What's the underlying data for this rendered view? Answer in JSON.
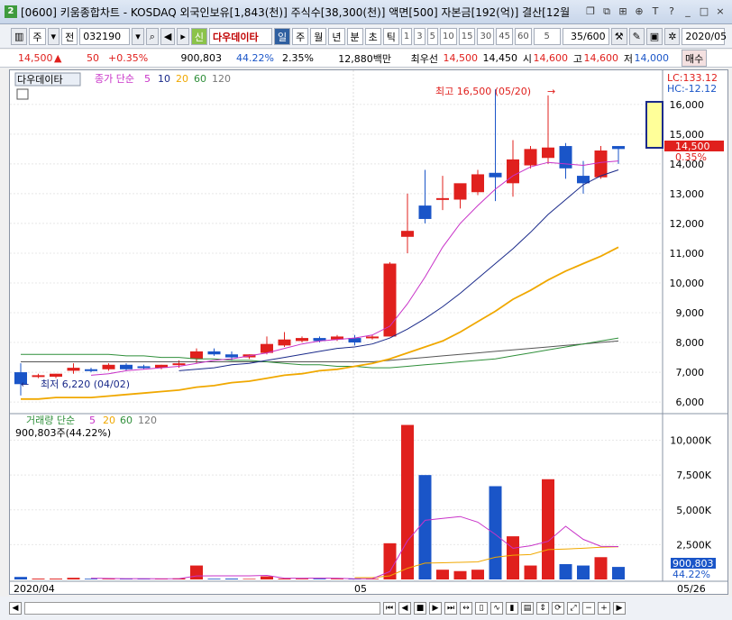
{
  "window": {
    "number": "2",
    "title": "[0600] 키움종합차트 - KOSDAQ 외국인보유[1,843(천)] 주식수[38,300(천)] 액면[500] 자본금[192(억)] 결산[12월"
  },
  "toolbar": {
    "market": "주",
    "prev": "전",
    "code": "032190",
    "search_icon": "search-icon",
    "badge": "신",
    "stock_name": "다우데이타",
    "periods": [
      "일",
      "주",
      "월",
      "년",
      "분",
      "초",
      "틱"
    ],
    "selected_period": "일",
    "intervals": [
      "1",
      "3",
      "5",
      "10",
      "15",
      "30",
      "45",
      "60"
    ],
    "interval_select": "5",
    "count": "35/600",
    "date": "2020/05"
  },
  "info": {
    "price": "14,500",
    "arrow": "▲",
    "change": "50",
    "change_pct": "+0.35%",
    "volume": "900,803",
    "vol_ratio": "44.22%",
    "turnover": "2.35%",
    "trade_value": "12,880백만",
    "best_label": "최우선",
    "best_ask": "14,500",
    "best_bid": "14,450",
    "open_label": "시",
    "open": "14,600",
    "high_label": "고",
    "high": "14,600",
    "low_label": "저",
    "low": "14,000",
    "buy_button": "매수"
  },
  "price_panel": {
    "stock": "다우데이타",
    "legend_label": "종가 단순",
    "ma": [
      "5",
      "10",
      "20",
      "60",
      "120"
    ],
    "lc": "LC:133.12",
    "hc": "HC:-12.12",
    "high_note": "최고 16,500 (05/20)",
    "low_note": "최저 6,220 (04/02)",
    "last_price": "14,500",
    "last_pct": "0.35%",
    "y_ticks": [
      "16,000",
      "15,000",
      "14,000",
      "13,000",
      "12,000",
      "11,000",
      "10,000",
      "9,000",
      "8,000",
      "7,000",
      "6,000"
    ]
  },
  "volume_panel": {
    "legend_label": "거래량 단순",
    "ma": [
      "5",
      "20",
      "60",
      "120"
    ],
    "current": "900,803주(44.22%)",
    "y_ticks": [
      "10,000K",
      "7,500K",
      "5,000K",
      "2,500K"
    ],
    "last_volume": "900,803",
    "last_pct": "44.22%"
  },
  "x_axis": {
    "labels": [
      "2020/04",
      "05",
      "05/26"
    ]
  },
  "colors": {
    "up": "#e0201d",
    "down": "#1a55c8",
    "ma5": "#c832c8",
    "ma10": "#1a2a8a",
    "ma20": "#f0a800",
    "ma60": "#2f8f3a",
    "ma120": "#555555"
  },
  "chart_data": {
    "type": "candlestick",
    "candles": [
      {
        "o": 7000,
        "h": 7300,
        "l": 6220,
        "c": 6600
      },
      {
        "o": 6850,
        "h": 6950,
        "l": 6800,
        "c": 6900
      },
      {
        "o": 6850,
        "h": 6950,
        "l": 6800,
        "c": 6950
      },
      {
        "o": 7050,
        "h": 7300,
        "l": 6950,
        "c": 7150
      },
      {
        "o": 7100,
        "h": 7150,
        "l": 7000,
        "c": 7050
      },
      {
        "o": 7100,
        "h": 7300,
        "l": 7050,
        "c": 7250
      },
      {
        "o": 7250,
        "h": 7300,
        "l": 7050,
        "c": 7100
      },
      {
        "o": 7200,
        "h": 7250,
        "l": 7100,
        "c": 7150
      },
      {
        "o": 7150,
        "h": 7250,
        "l": 7100,
        "c": 7250
      },
      {
        "o": 7250,
        "h": 7400,
        "l": 7150,
        "c": 7300
      },
      {
        "o": 7450,
        "h": 7800,
        "l": 7300,
        "c": 7700
      },
      {
        "o": 7700,
        "h": 7800,
        "l": 7550,
        "c": 7600
      },
      {
        "o": 7600,
        "h": 7700,
        "l": 7400,
        "c": 7500
      },
      {
        "o": 7500,
        "h": 7600,
        "l": 7450,
        "c": 7600
      },
      {
        "o": 7650,
        "h": 8200,
        "l": 7600,
        "c": 7950
      },
      {
        "o": 7900,
        "h": 8350,
        "l": 7850,
        "c": 8100
      },
      {
        "o": 8050,
        "h": 8200,
        "l": 8000,
        "c": 8150
      },
      {
        "o": 8150,
        "h": 8200,
        "l": 8000,
        "c": 8050
      },
      {
        "o": 8100,
        "h": 8250,
        "l": 8050,
        "c": 8200
      },
      {
        "o": 8150,
        "h": 8250,
        "l": 7900,
        "c": 8000
      },
      {
        "o": 8150,
        "h": 8250,
        "l": 8100,
        "c": 8200
      },
      {
        "o": 8200,
        "h": 10700,
        "l": 8200,
        "c": 10650
      },
      {
        "o": 11550,
        "h": 13000,
        "l": 11000,
        "c": 11750
      },
      {
        "o": 12600,
        "h": 13800,
        "l": 12000,
        "c": 12150
      },
      {
        "o": 12800,
        "h": 13600,
        "l": 12450,
        "c": 12850
      },
      {
        "o": 12800,
        "h": 13100,
        "l": 12500,
        "c": 13350
      },
      {
        "o": 13050,
        "h": 13800,
        "l": 12950,
        "c": 13650
      },
      {
        "o": 13700,
        "h": 16500,
        "l": 12750,
        "c": 13550
      },
      {
        "o": 13350,
        "h": 14800,
        "l": 12900,
        "c": 14150
      },
      {
        "o": 13950,
        "h": 14600,
        "l": 13850,
        "c": 14500
      },
      {
        "o": 14200,
        "h": 16300,
        "l": 14000,
        "c": 14550
      },
      {
        "o": 14600,
        "h": 14700,
        "l": 13500,
        "c": 13850
      },
      {
        "o": 13600,
        "h": 14100,
        "l": 13000,
        "c": 13350
      },
      {
        "o": 13550,
        "h": 14600,
        "l": 13500,
        "c": 14450
      },
      {
        "o": 14600,
        "h": 14600,
        "l": 14000,
        "c": 14500
      }
    ],
    "volumes_k": [
      180,
      60,
      60,
      120,
      50,
      40,
      40,
      60,
      60,
      80,
      1000,
      50,
      60,
      40,
      220,
      60,
      50,
      50,
      50,
      40,
      50,
      2600,
      11100,
      7500,
      700,
      600,
      700,
      6700,
      3100,
      1000,
      7200,
      1100,
      1000,
      1600,
      900
    ],
    "ma5": [
      null,
      null,
      null,
      null,
      6900,
      6950,
      7050,
      7100,
      7150,
      7200,
      7300,
      7400,
      7450,
      7550,
      7650,
      7800,
      7950,
      8050,
      8100,
      8150,
      8250,
      8550,
      9300,
      10200,
      11200,
      12000,
      12600,
      13150,
      13600,
      13900,
      14050,
      14000,
      13950,
      14050,
      14100
    ],
    "ma10": [
      null,
      null,
      null,
      null,
      null,
      null,
      null,
      null,
      null,
      7050,
      7100,
      7150,
      7250,
      7300,
      7400,
      7500,
      7600,
      7700,
      7800,
      7850,
      7950,
      8150,
      8450,
      8800,
      9200,
      9650,
      10150,
      10650,
      11150,
      11700,
      12300,
      12800,
      13300,
      13600,
      13800
    ],
    "ma20": [
      6100,
      6100,
      6150,
      6150,
      6150,
      6200,
      6250,
      6300,
      6350,
      6400,
      6500,
      6550,
      6650,
      6700,
      6800,
      6900,
      6950,
      7050,
      7100,
      7200,
      7300,
      7450,
      7650,
      7850,
      8050,
      8350,
      8700,
      9050,
      9450,
      9750,
      10100,
      10400,
      10650,
      10900,
      11200
    ],
    "ma60": [
      7600,
      7600,
      7600,
      7600,
      7600,
      7600,
      7550,
      7550,
      7500,
      7500,
      7450,
      7450,
      7400,
      7400,
      7350,
      7300,
      7250,
      7250,
      7200,
      7200,
      7150,
      7150,
      7200,
      7250,
      7300,
      7350,
      7400,
      7450,
      7550,
      7650,
      7750,
      7850,
      7950,
      8050,
      8150
    ],
    "ma120": [
      7350,
      7350,
      7350,
      7350,
      7350,
      7350,
      7350,
      7350,
      7350,
      7350,
      7350,
      7350,
      7350,
      7350,
      7350,
      7350,
      7350,
      7350,
      7350,
      7350,
      7350,
      7400,
      7450,
      7500,
      7550,
      7600,
      7650,
      7700,
      7750,
      7800,
      7850,
      7900,
      7950,
      8000,
      8050
    ],
    "vol_ma5": [
      null,
      null,
      null,
      null,
      90,
      70,
      60,
      60,
      50,
      60,
      250,
      260,
      260,
      260,
      290,
      90,
      90,
      100,
      90,
      50,
      50,
      570,
      2780,
      4250,
      4390,
      4520,
      4120,
      3240,
      2240,
      2420,
      2740,
      3820,
      2880,
      2380,
      2360
    ],
    "vol_ma20": [
      null,
      null,
      null,
      null,
      null,
      null,
      null,
      null,
      null,
      null,
      null,
      null,
      null,
      null,
      null,
      null,
      null,
      null,
      null,
      130,
      130,
      260,
      800,
      1170,
      1200,
      1230,
      1260,
      1590,
      1740,
      1790,
      2140,
      2190,
      2240,
      2310,
      2350
    ],
    "y_range": [
      5700,
      16600
    ],
    "vol_range_k": [
      0,
      11200
    ]
  }
}
